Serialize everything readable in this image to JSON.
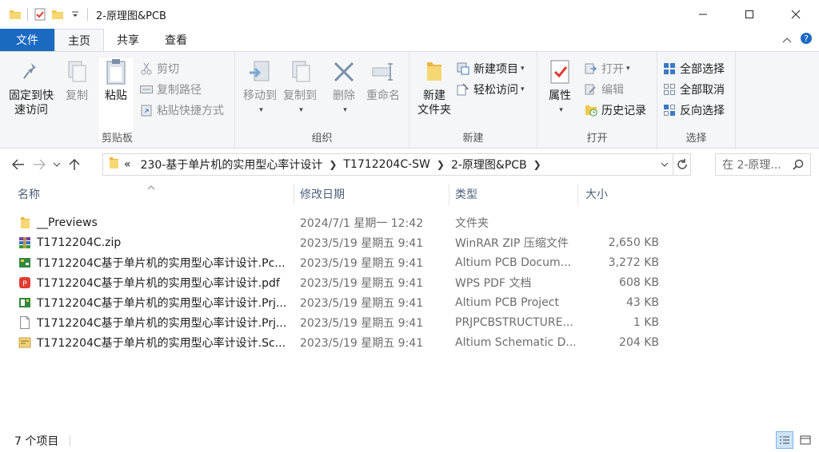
{
  "window": {
    "title": "2-原理图&PCB",
    "controls": {
      "minimize": "minimize-icon",
      "maximize": "maximize-icon",
      "close": "close-icon"
    }
  },
  "ribbon_tabs": [
    {
      "label": "文件"
    },
    {
      "label": "主页"
    },
    {
      "label": "共享"
    },
    {
      "label": "查看"
    }
  ],
  "ribbon": {
    "clipboard": {
      "label": "剪贴板",
      "pin_quick_access": "固定到快\n速访问",
      "pin_line1": "固定到快",
      "pin_line2": "速访问",
      "copy": "复制",
      "paste": "粘贴",
      "cut": "剪切",
      "copy_path": "复制路径",
      "paste_shortcut": "粘贴快捷方式"
    },
    "organize": {
      "label": "组织",
      "move_to": "移动到",
      "copy_to": "复制到",
      "delete": "删除",
      "rename": "重命名"
    },
    "new": {
      "label": "新建",
      "new_folder_line1": "新建",
      "new_folder_line2": "文件夹",
      "new_item": "新建项目",
      "easy_access": "轻松访问"
    },
    "open": {
      "label": "打开",
      "properties": "属性",
      "open": "打开",
      "edit": "编辑",
      "history": "历史记录"
    },
    "select": {
      "label": "选择",
      "select_all": "全部选择",
      "select_none": "全部取消",
      "invert": "反向选择"
    }
  },
  "address": {
    "prefix": "«",
    "crumbs": [
      "230-基于单片机的实用型心率计设计",
      "T1712204C-SW",
      "2-原理图&PCB"
    ],
    "search_placeholder": "在 2-原理..."
  },
  "columns": [
    "名称",
    "修改日期",
    "类型",
    "大小"
  ],
  "files": [
    {
      "name": "__Previews",
      "date": "2024/7/1 星期一 12:42",
      "type": "文件夹",
      "size": "",
      "icon": "folder-icon"
    },
    {
      "name": "T1712204C.zip",
      "date": "2023/5/19 星期五 9:41",
      "type": "WinRAR ZIP 压缩文件",
      "size": "2,650 KB",
      "icon": "winrar-icon"
    },
    {
      "name": "T1712204C基于单片机的实用型心率计设计.Pc...",
      "date": "2023/5/19 星期五 9:41",
      "type": "Altium PCB Docum...",
      "size": "3,272 KB",
      "icon": "pcb-doc-icon"
    },
    {
      "name": "T1712204C基于单片机的实用型心率计设计.pdf",
      "date": "2023/5/19 星期五 9:41",
      "type": "WPS PDF 文档",
      "size": "608 KB",
      "icon": "pdf-icon"
    },
    {
      "name": "T1712204C基于单片机的实用型心率计设计.Prj...",
      "date": "2023/5/19 星期五 9:41",
      "type": "Altium PCB Project",
      "size": "43 KB",
      "icon": "pcb-project-icon"
    },
    {
      "name": "T1712204C基于单片机的实用型心率计设计.Prj...",
      "date": "2023/5/19 星期五 9:41",
      "type": "PRJPCBSTRUCTURE...",
      "size": "1 KB",
      "icon": "blank-file-icon"
    },
    {
      "name": "T1712204C基于单片机的实用型心率计设计.Sc...",
      "date": "2023/5/19 星期五 9:41",
      "type": "Altium Schematic D...",
      "size": "204 KB",
      "icon": "schematic-icon"
    }
  ],
  "status": {
    "item_count": "7 个项目"
  },
  "colors": {
    "accent": "#1a6ac2",
    "ribbon_bg": "#f5f6f7",
    "header_text": "#4c607a"
  }
}
